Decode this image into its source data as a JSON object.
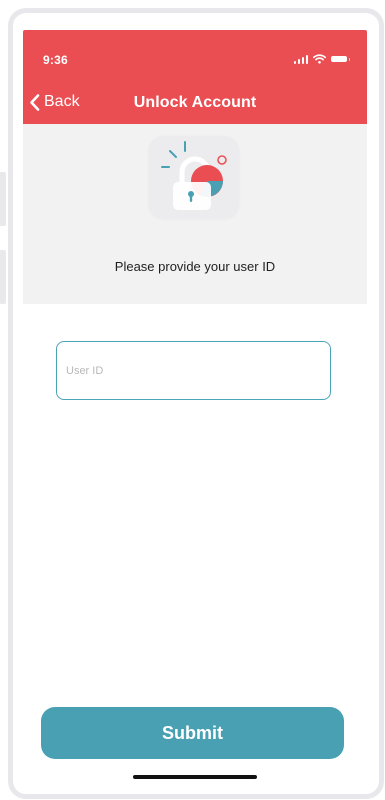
{
  "status_bar": {
    "time": "9:36",
    "signal_icon": "cellular-signal-icon",
    "wifi_icon": "wifi-icon",
    "battery_icon": "battery-icon"
  },
  "nav": {
    "back_label": "Back",
    "title": "Unlock Account",
    "back_icon": "chevron-left-icon"
  },
  "hero": {
    "illustration_icon": "padlock-illustration-icon",
    "prompt": "Please provide your user ID"
  },
  "form": {
    "user_id": {
      "value": "",
      "placeholder": "User ID"
    },
    "submit_label": "Submit"
  },
  "colors": {
    "header": "#ea4e52",
    "accent": "#4aa0b3",
    "hero_background": "#f2f2f3"
  }
}
